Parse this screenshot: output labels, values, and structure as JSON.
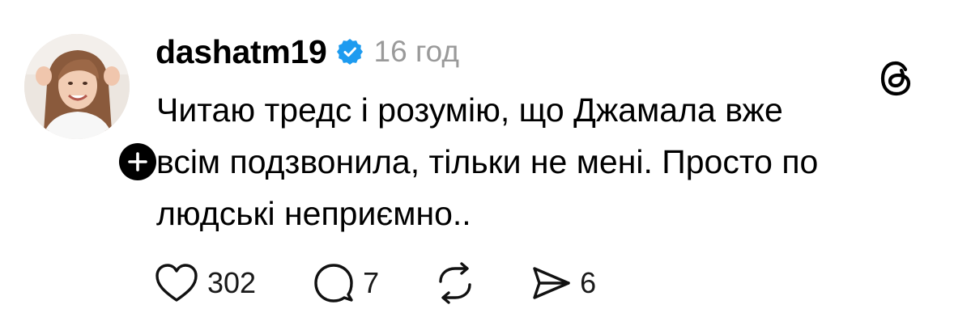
{
  "post": {
    "username": "dashatm19",
    "verified": true,
    "time_ago": "16 год",
    "text": "Читаю тредс і розумію, що Джамала вже всім подзвонила, тільки не мені. Просто по людські неприємно..",
    "text_lines": [
      "Читаю тредс і розумію, що Джамала вже",
      "всім подзвонила, тільки не мені. Просто по",
      "людські неприємно.."
    ]
  },
  "actions": {
    "likes": "302",
    "replies": "7",
    "shares": "6"
  },
  "icons": {
    "avatar": "profile-photo",
    "follow": "plus-icon",
    "verified": "verified-badge-icon",
    "brand": "threads-logo-icon",
    "like": "heart-icon",
    "reply": "speech-bubble-icon",
    "repost": "repost-icon",
    "share": "paper-plane-icon"
  },
  "colors": {
    "verified_blue": "#1d9bf0",
    "time_gray": "#9a9a9a",
    "text": "#000000",
    "background": "#ffffff"
  }
}
